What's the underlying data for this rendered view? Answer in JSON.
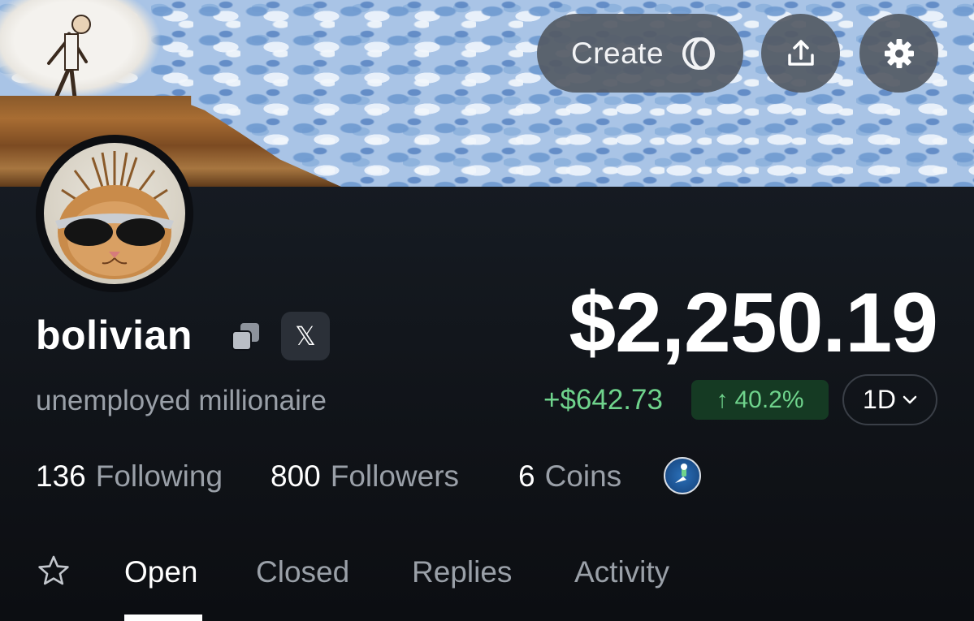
{
  "header": {
    "create_label": "Create",
    "create_icon": "coin-logo-icon",
    "share_icon": "share-upload-icon",
    "settings_icon": "gear-icon"
  },
  "profile": {
    "username": "bolivian",
    "bio": "unemployed millionaire",
    "social_badge": "𝕏"
  },
  "portfolio": {
    "value": "$2,250.19",
    "change": "+$642.73",
    "change_percent": "40.2%",
    "change_arrow": "↑",
    "period": "1D",
    "positive_color": "#6fd38c"
  },
  "stats": {
    "following_count": "136",
    "following_label": "Following",
    "followers_count": "800",
    "followers_label": "Followers",
    "coins_count": "6",
    "coins_label": "Coins"
  },
  "tabs": [
    {
      "label": "Open",
      "active": true
    },
    {
      "label": "Closed",
      "active": false
    },
    {
      "label": "Replies",
      "active": false
    },
    {
      "label": "Activity",
      "active": false
    }
  ]
}
